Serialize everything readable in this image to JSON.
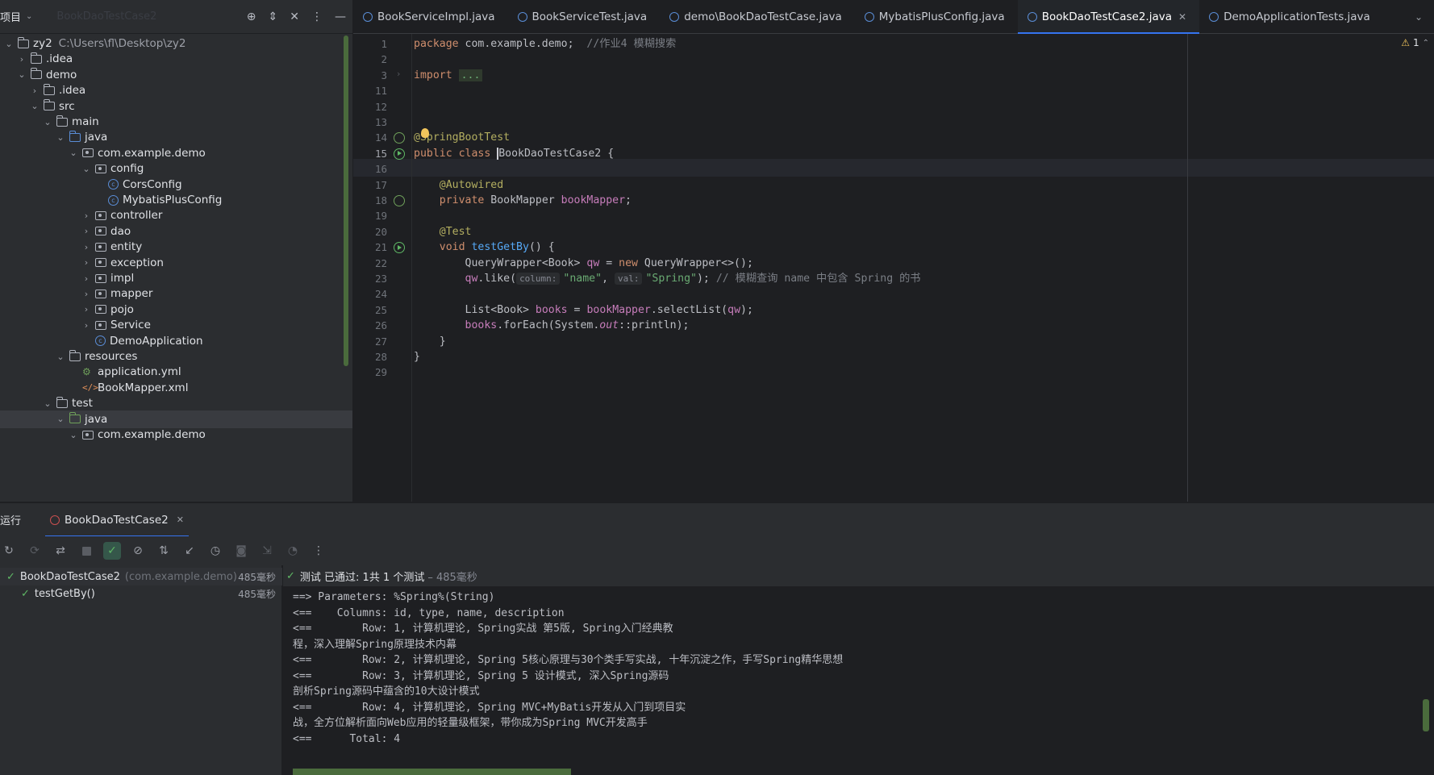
{
  "project_panel": {
    "title": "项目",
    "faded_title": "BookDaoTestCase2",
    "tree": [
      {
        "label": "zy2",
        "path": "C:\\Users\\fl\\Desktop\\zy2",
        "depth": 0,
        "type": "module",
        "expanded": true
      },
      {
        "label": ".idea",
        "depth": 1,
        "type": "folder",
        "expanded": false
      },
      {
        "label": "demo",
        "depth": 1,
        "type": "module",
        "expanded": true
      },
      {
        "label": ".idea",
        "depth": 2,
        "type": "folder",
        "expanded": false
      },
      {
        "label": "src",
        "depth": 2,
        "type": "folder",
        "expanded": true
      },
      {
        "label": "main",
        "depth": 3,
        "type": "folder",
        "expanded": true
      },
      {
        "label": "java",
        "depth": 4,
        "type": "folder-blue",
        "expanded": true
      },
      {
        "label": "com.example.demo",
        "depth": 5,
        "type": "package",
        "expanded": true
      },
      {
        "label": "config",
        "depth": 6,
        "type": "package",
        "expanded": true
      },
      {
        "label": "CorsConfig",
        "depth": 7,
        "type": "class"
      },
      {
        "label": "MybatisPlusConfig",
        "depth": 7,
        "type": "class"
      },
      {
        "label": "controller",
        "depth": 6,
        "type": "package",
        "expanded": false
      },
      {
        "label": "dao",
        "depth": 6,
        "type": "package",
        "expanded": false
      },
      {
        "label": "entity",
        "depth": 6,
        "type": "package",
        "expanded": false
      },
      {
        "label": "exception",
        "depth": 6,
        "type": "package",
        "expanded": false
      },
      {
        "label": "impl",
        "depth": 6,
        "type": "package",
        "expanded": false
      },
      {
        "label": "mapper",
        "depth": 6,
        "type": "package",
        "expanded": false
      },
      {
        "label": "pojo",
        "depth": 6,
        "type": "package",
        "expanded": false
      },
      {
        "label": "Service",
        "depth": 6,
        "type": "package",
        "expanded": false
      },
      {
        "label": "DemoApplication",
        "depth": 6,
        "type": "class"
      },
      {
        "label": "resources",
        "depth": 4,
        "type": "folder",
        "expanded": true
      },
      {
        "label": "application.yml",
        "depth": 5,
        "type": "yml"
      },
      {
        "label": "BookMapper.xml",
        "depth": 5,
        "type": "xml"
      },
      {
        "label": "test",
        "depth": 3,
        "type": "folder",
        "expanded": true
      },
      {
        "label": "java",
        "depth": 4,
        "type": "folder-green",
        "expanded": true,
        "highlight": true
      },
      {
        "label": "com.example.demo",
        "depth": 5,
        "type": "package",
        "expanded": true
      }
    ]
  },
  "editor_tabs": [
    {
      "label": "BookServiceImpl.java",
      "active": false
    },
    {
      "label": "BookServiceTest.java",
      "active": false
    },
    {
      "label": "demo\\BookDaoTestCase.java",
      "active": false
    },
    {
      "label": "MybatisPlusConfig.java",
      "active": false
    },
    {
      "label": "BookDaoTestCase2.java",
      "active": true
    },
    {
      "label": "DemoApplicationTests.java",
      "active": false
    }
  ],
  "editor": {
    "warning_count": "1",
    "lines": [
      {
        "num": "1",
        "segments": [
          [
            "kw",
            "package "
          ],
          [
            "cls",
            "com.example.demo"
          ],
          [
            "",
            "; "
          ],
          [
            "cmt",
            " //作业4 模糊搜索"
          ]
        ]
      },
      {
        "num": "2",
        "segments": []
      },
      {
        "num": "3",
        "segments": [
          [
            "kw",
            "import "
          ],
          [
            "dots",
            "..."
          ]
        ]
      },
      {
        "num": "11",
        "segments": []
      },
      {
        "num": "12",
        "segments": []
      },
      {
        "num": "13",
        "segments": []
      },
      {
        "num": "14",
        "segments": [
          [
            "ann",
            "@SpringBootTest"
          ]
        ]
      },
      {
        "num": "15",
        "segments": [
          [
            "kw",
            "public class "
          ],
          [
            "cursor",
            "BookDaoTestCase2"
          ],
          [
            "",
            " {"
          ]
        ]
      },
      {
        "num": "16",
        "segments": []
      },
      {
        "num": "17",
        "segments": [
          [
            "",
            "    "
          ],
          [
            "ann",
            "@Autowired"
          ]
        ]
      },
      {
        "num": "18",
        "segments": [
          [
            "",
            "    "
          ],
          [
            "kw",
            "private "
          ],
          [
            "cls",
            "BookMapper "
          ],
          [
            "fld",
            "bookMapper"
          ],
          [
            "",
            ";"
          ]
        ]
      },
      {
        "num": "19",
        "segments": []
      },
      {
        "num": "20",
        "segments": [
          [
            "",
            "    "
          ],
          [
            "ann",
            "@Test"
          ]
        ]
      },
      {
        "num": "21",
        "segments": [
          [
            "",
            "    "
          ],
          [
            "kw",
            "void "
          ],
          [
            "fn",
            "testGetBy"
          ],
          [
            "",
            "() {"
          ]
        ]
      },
      {
        "num": "22",
        "segments": [
          [
            "",
            "        "
          ],
          [
            "cls",
            "QueryWrapper"
          ],
          [
            "",
            "<"
          ],
          [
            "cls",
            "Book"
          ],
          [
            "",
            "> "
          ],
          [
            "fld",
            "qw"
          ],
          [
            "",
            " = "
          ],
          [
            "kw",
            "new "
          ],
          [
            "",
            "QueryWrapper<>();"
          ]
        ]
      },
      {
        "num": "23",
        "segments": [
          [
            "",
            "        "
          ],
          [
            "fld",
            "qw"
          ],
          [
            "",
            ".like("
          ],
          [
            "hint",
            "column:"
          ],
          [
            "str",
            "\"name\""
          ],
          [
            "",
            ", "
          ],
          [
            "hint",
            "val:"
          ],
          [
            "str",
            "\"Spring\""
          ],
          [
            "",
            "); "
          ],
          [
            "cmt",
            "// 模糊查询 name 中包含 Spring 的书"
          ]
        ]
      },
      {
        "num": "24",
        "segments": []
      },
      {
        "num": "25",
        "segments": [
          [
            "",
            "        "
          ],
          [
            "cls",
            "List"
          ],
          [
            "",
            "<"
          ],
          [
            "cls",
            "Book"
          ],
          [
            "",
            "> "
          ],
          [
            "fld",
            "books"
          ],
          [
            "",
            " = "
          ],
          [
            "fld",
            "bookMapper"
          ],
          [
            "",
            ".selectList("
          ],
          [
            "fld",
            "qw"
          ],
          [
            "",
            ");"
          ]
        ]
      },
      {
        "num": "26",
        "segments": [
          [
            "",
            "        "
          ],
          [
            "fld",
            "books"
          ],
          [
            "",
            ".forEach("
          ],
          [
            "cls",
            "System"
          ],
          [
            "",
            "."
          ],
          [
            "static",
            "out"
          ],
          [
            "",
            "::println);"
          ]
        ]
      },
      {
        "num": "27",
        "segments": [
          [
            "",
            "    }"
          ]
        ]
      },
      {
        "num": "28",
        "segments": [
          [
            "",
            "}"
          ]
        ]
      },
      {
        "num": "29",
        "segments": []
      }
    ]
  },
  "run_panel": {
    "title": "运行",
    "tab_label": "BookDaoTestCase2",
    "tests": [
      {
        "label": "BookDaoTestCase2",
        "pkg": "(com.example.demo)",
        "duration": "485毫秒",
        "depth": 0
      },
      {
        "label": "testGetBy()",
        "pkg": "",
        "duration": "485毫秒",
        "depth": 1
      }
    ],
    "status": "测试 已通过: 1共 1 个测试",
    "status_duration": "– 485毫秒",
    "output": [
      "==> Parameters: %Spring%(String)",
      "<==    Columns: id, type, name, description",
      "<==        Row: 1, 计算机理论, Spring实战 第5版, Spring入门经典教",
      "程，深入理解Spring原理技术内幕",
      "<==        Row: 2, 计算机理论, Spring 5核心原理与30个类手写实战, 十年沉淀之作，手写Spring精华思想",
      "<==        Row: 3, 计算机理论, Spring 5 设计模式, 深入Spring源码",
      "剖析Spring源码中蕴含的10大设计模式",
      "<==        Row: 4, 计算机理论, Spring MVC+MyBatis开发从入门到项目实",
      "战，全方位解析面向Web应用的轻量级框架，带你成为Spring MVC开发高手",
      "<==      Total: 4"
    ]
  }
}
